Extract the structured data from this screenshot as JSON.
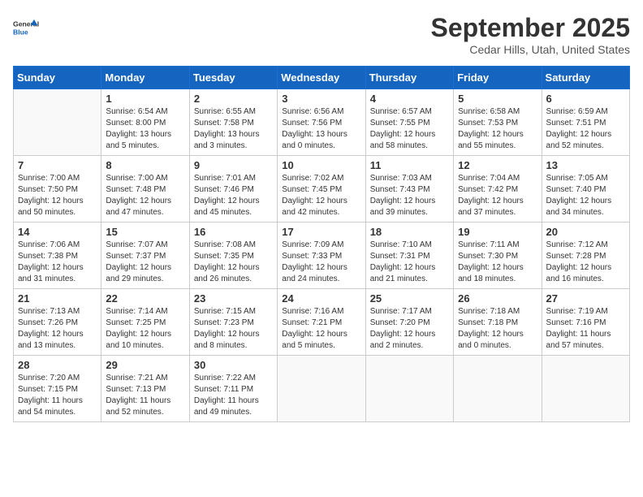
{
  "header": {
    "logo_line1": "General",
    "logo_line2": "Blue",
    "month": "September 2025",
    "location": "Cedar Hills, Utah, United States"
  },
  "weekdays": [
    "Sunday",
    "Monday",
    "Tuesday",
    "Wednesday",
    "Thursday",
    "Friday",
    "Saturday"
  ],
  "weeks": [
    [
      {
        "day": "",
        "info": ""
      },
      {
        "day": "1",
        "info": "Sunrise: 6:54 AM\nSunset: 8:00 PM\nDaylight: 13 hours\nand 5 minutes."
      },
      {
        "day": "2",
        "info": "Sunrise: 6:55 AM\nSunset: 7:58 PM\nDaylight: 13 hours\nand 3 minutes."
      },
      {
        "day": "3",
        "info": "Sunrise: 6:56 AM\nSunset: 7:56 PM\nDaylight: 13 hours\nand 0 minutes."
      },
      {
        "day": "4",
        "info": "Sunrise: 6:57 AM\nSunset: 7:55 PM\nDaylight: 12 hours\nand 58 minutes."
      },
      {
        "day": "5",
        "info": "Sunrise: 6:58 AM\nSunset: 7:53 PM\nDaylight: 12 hours\nand 55 minutes."
      },
      {
        "day": "6",
        "info": "Sunrise: 6:59 AM\nSunset: 7:51 PM\nDaylight: 12 hours\nand 52 minutes."
      }
    ],
    [
      {
        "day": "7",
        "info": "Sunrise: 7:00 AM\nSunset: 7:50 PM\nDaylight: 12 hours\nand 50 minutes."
      },
      {
        "day": "8",
        "info": "Sunrise: 7:00 AM\nSunset: 7:48 PM\nDaylight: 12 hours\nand 47 minutes."
      },
      {
        "day": "9",
        "info": "Sunrise: 7:01 AM\nSunset: 7:46 PM\nDaylight: 12 hours\nand 45 minutes."
      },
      {
        "day": "10",
        "info": "Sunrise: 7:02 AM\nSunset: 7:45 PM\nDaylight: 12 hours\nand 42 minutes."
      },
      {
        "day": "11",
        "info": "Sunrise: 7:03 AM\nSunset: 7:43 PM\nDaylight: 12 hours\nand 39 minutes."
      },
      {
        "day": "12",
        "info": "Sunrise: 7:04 AM\nSunset: 7:42 PM\nDaylight: 12 hours\nand 37 minutes."
      },
      {
        "day": "13",
        "info": "Sunrise: 7:05 AM\nSunset: 7:40 PM\nDaylight: 12 hours\nand 34 minutes."
      }
    ],
    [
      {
        "day": "14",
        "info": "Sunrise: 7:06 AM\nSunset: 7:38 PM\nDaylight: 12 hours\nand 31 minutes."
      },
      {
        "day": "15",
        "info": "Sunrise: 7:07 AM\nSunset: 7:37 PM\nDaylight: 12 hours\nand 29 minutes."
      },
      {
        "day": "16",
        "info": "Sunrise: 7:08 AM\nSunset: 7:35 PM\nDaylight: 12 hours\nand 26 minutes."
      },
      {
        "day": "17",
        "info": "Sunrise: 7:09 AM\nSunset: 7:33 PM\nDaylight: 12 hours\nand 24 minutes."
      },
      {
        "day": "18",
        "info": "Sunrise: 7:10 AM\nSunset: 7:31 PM\nDaylight: 12 hours\nand 21 minutes."
      },
      {
        "day": "19",
        "info": "Sunrise: 7:11 AM\nSunset: 7:30 PM\nDaylight: 12 hours\nand 18 minutes."
      },
      {
        "day": "20",
        "info": "Sunrise: 7:12 AM\nSunset: 7:28 PM\nDaylight: 12 hours\nand 16 minutes."
      }
    ],
    [
      {
        "day": "21",
        "info": "Sunrise: 7:13 AM\nSunset: 7:26 PM\nDaylight: 12 hours\nand 13 minutes."
      },
      {
        "day": "22",
        "info": "Sunrise: 7:14 AM\nSunset: 7:25 PM\nDaylight: 12 hours\nand 10 minutes."
      },
      {
        "day": "23",
        "info": "Sunrise: 7:15 AM\nSunset: 7:23 PM\nDaylight: 12 hours\nand 8 minutes."
      },
      {
        "day": "24",
        "info": "Sunrise: 7:16 AM\nSunset: 7:21 PM\nDaylight: 12 hours\nand 5 minutes."
      },
      {
        "day": "25",
        "info": "Sunrise: 7:17 AM\nSunset: 7:20 PM\nDaylight: 12 hours\nand 2 minutes."
      },
      {
        "day": "26",
        "info": "Sunrise: 7:18 AM\nSunset: 7:18 PM\nDaylight: 12 hours\nand 0 minutes."
      },
      {
        "day": "27",
        "info": "Sunrise: 7:19 AM\nSunset: 7:16 PM\nDaylight: 11 hours\nand 57 minutes."
      }
    ],
    [
      {
        "day": "28",
        "info": "Sunrise: 7:20 AM\nSunset: 7:15 PM\nDaylight: 11 hours\nand 54 minutes."
      },
      {
        "day": "29",
        "info": "Sunrise: 7:21 AM\nSunset: 7:13 PM\nDaylight: 11 hours\nand 52 minutes."
      },
      {
        "day": "30",
        "info": "Sunrise: 7:22 AM\nSunset: 7:11 PM\nDaylight: 11 hours\nand 49 minutes."
      },
      {
        "day": "",
        "info": ""
      },
      {
        "day": "",
        "info": ""
      },
      {
        "day": "",
        "info": ""
      },
      {
        "day": "",
        "info": ""
      }
    ]
  ]
}
